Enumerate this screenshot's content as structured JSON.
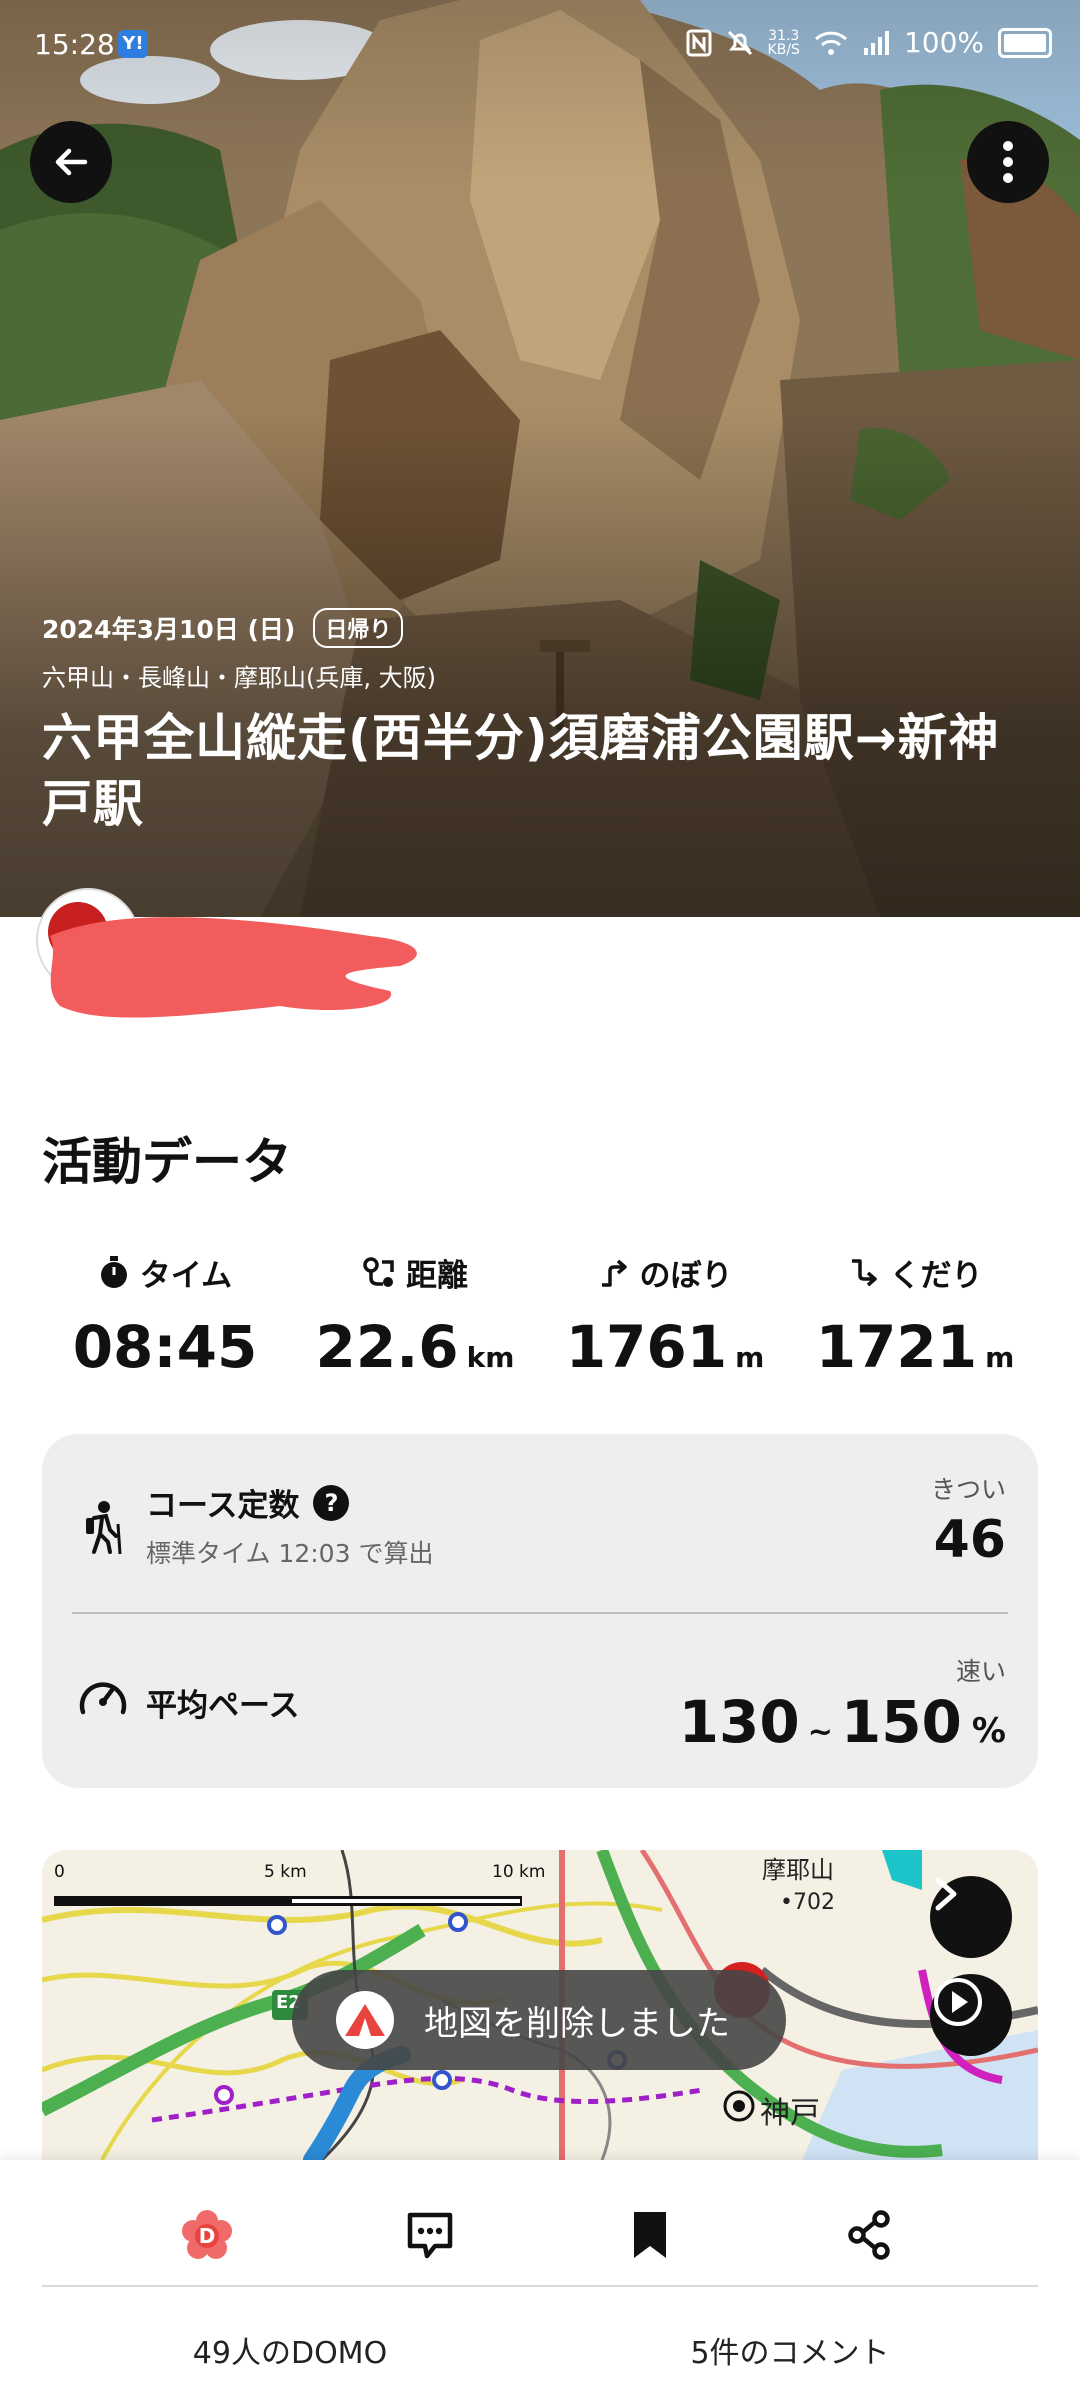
{
  "status_bar": {
    "time": "15:28",
    "app_badge": "Y!",
    "net_speed": "31.3",
    "net_unit": "KB/S",
    "battery": "100%"
  },
  "header": {
    "date": "2024年3月10日 (日)",
    "trip_type": "日帰り",
    "area": "六甲山・長峰山・摩耶山(兵庫, 大阪)",
    "title": "六甲全山縦走(西半分)須磨浦公園駅→新神戸駅"
  },
  "activity": {
    "section_title": "活動データ",
    "stats": [
      {
        "label": "タイム",
        "icon": "stopwatch-icon",
        "value": "08:45",
        "unit": ""
      },
      {
        "label": "距離",
        "icon": "route-icon",
        "value": "22.6",
        "unit": "km"
      },
      {
        "label": "のぼり",
        "icon": "ascent-icon",
        "value": "1761",
        "unit": "m"
      },
      {
        "label": "くだり",
        "icon": "descent-icon",
        "value": "1721",
        "unit": "m"
      }
    ],
    "course": {
      "label": "コース定数",
      "help": "?",
      "sub": "標準タイム 12:03 で算出",
      "level": "きつい",
      "value": "46"
    },
    "pace": {
      "label": "平均ペース",
      "level": "速い",
      "min": "130",
      "sep": "~",
      "max": "150",
      "unit": "%"
    }
  },
  "map": {
    "scale_labels": [
      "0",
      "5 km",
      "10 km"
    ],
    "place_labels": [
      "摩耶山",
      "•702",
      "神戸"
    ],
    "road_badge": "E2"
  },
  "toast": {
    "message": "地図を削除しました"
  },
  "bottom": {
    "domo_label": "49人のDOMO",
    "comment_label": "5件のコメント"
  },
  "colors": {
    "accent": "#e8433f",
    "dark": "#111111",
    "card_bg": "#eeeeee"
  }
}
